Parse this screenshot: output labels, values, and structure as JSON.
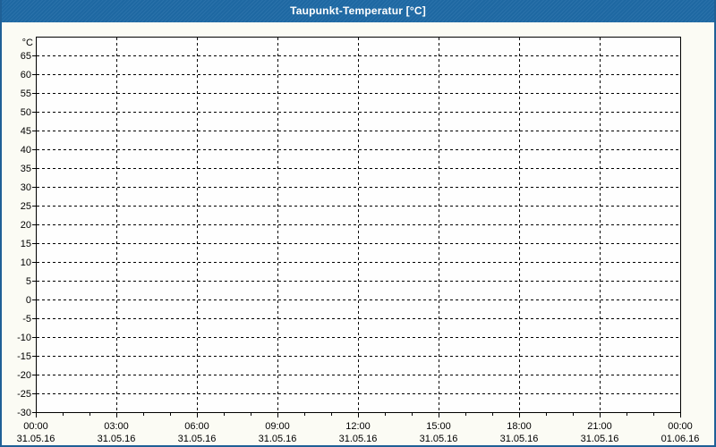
{
  "window": {
    "title": "Taupunkt-Temperatur [°C]"
  },
  "colors": {
    "titlebar_bg": "#1f6aa5",
    "title_text": "#ffffff",
    "window_border": "#1f6096",
    "content_bg": "#fbfbf4",
    "plot_bg": "#fefefe",
    "grid_line": "#000000",
    "axis_line": "#000000",
    "label_text": "#000000"
  },
  "chart_data": {
    "type": "line",
    "title": "Taupunkt-Temperatur [°C]",
    "ylabel": "°C",
    "xlabel": "",
    "ylim": [
      -30,
      70
    ],
    "y_tick_step": 5,
    "y_tick_labels": [
      65,
      60,
      55,
      50,
      45,
      40,
      35,
      30,
      25,
      20,
      15,
      10,
      5,
      0,
      -5,
      -10,
      -15,
      -20,
      -25,
      -30
    ],
    "x_range_hours": 24,
    "x_major_step_hours": 3,
    "x_minor_step_hours": 1,
    "x_ticks": [
      {
        "time": "00:00",
        "date": "31.05.16"
      },
      {
        "time": "03:00",
        "date": "31.05.16"
      },
      {
        "time": "06:00",
        "date": "31.05.16"
      },
      {
        "time": "09:00",
        "date": "31.05.16"
      },
      {
        "time": "12:00",
        "date": "31.05.16"
      },
      {
        "time": "15:00",
        "date": "31.05.16"
      },
      {
        "time": "18:00",
        "date": "31.05.16"
      },
      {
        "time": "21:00",
        "date": "31.05.16"
      },
      {
        "time": "00:00",
        "date": "01.06.16"
      }
    ],
    "grid": "dashed",
    "legend": null,
    "series": []
  }
}
